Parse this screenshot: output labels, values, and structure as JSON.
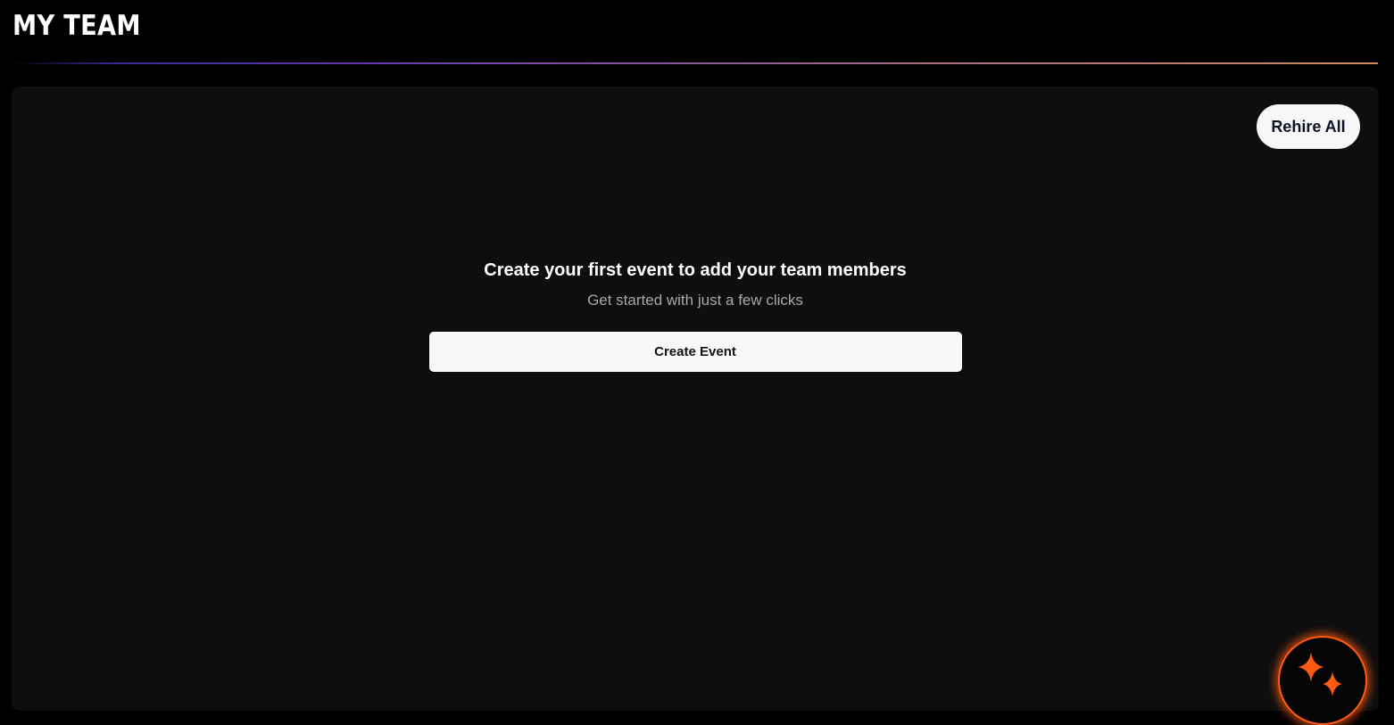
{
  "header": {
    "title": "MY TEAM"
  },
  "panel": {
    "rehire_label": "Rehire All",
    "empty_state": {
      "title": "Create your first event to add your team members",
      "subtitle": "Get started with just a few clicks",
      "button_label": "Create Event"
    }
  },
  "fab": {
    "icon": "sparkles-icon",
    "accent_color": "#ff5a12"
  },
  "colors": {
    "background": "#000000",
    "panel": "#0e0e0e",
    "button": "#f7f7f7",
    "accent": "#ff5a12"
  }
}
